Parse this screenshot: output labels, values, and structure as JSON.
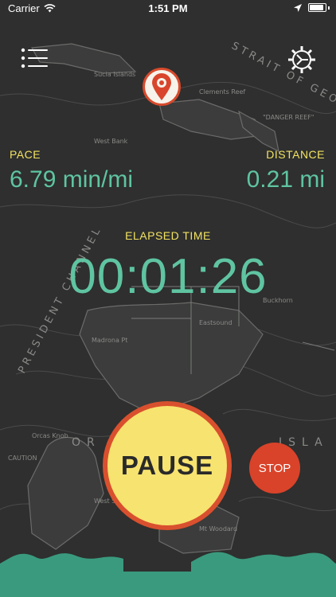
{
  "status_bar": {
    "carrier": "Carrier",
    "time": "1:51 PM",
    "icons": [
      "wifi-icon",
      "location-arrow-icon",
      "battery-icon"
    ]
  },
  "header": {
    "menu_icon": "list-menu-icon",
    "settings_icon": "gear-icon",
    "center_icon": "map-pin-icon"
  },
  "stats": {
    "pace_label": "PACE",
    "pace_value": "6.79 min/mi",
    "distance_label": "DISTANCE",
    "distance_value": "0.21 mi",
    "elapsed_label": "ELAPSED TIME",
    "elapsed_value": "00:01:26"
  },
  "controls": {
    "pause_label": "PAUSE",
    "stop_label": "STOP"
  },
  "colors": {
    "label_yellow": "#f3e262",
    "value_green": "#5fc4a1",
    "pause_fill": "#f7e36f",
    "accent_red": "#d9502e",
    "stop_red": "#d9432a",
    "water_teal": "#3a9a7e",
    "map_bg": "#2e2f2e"
  }
}
